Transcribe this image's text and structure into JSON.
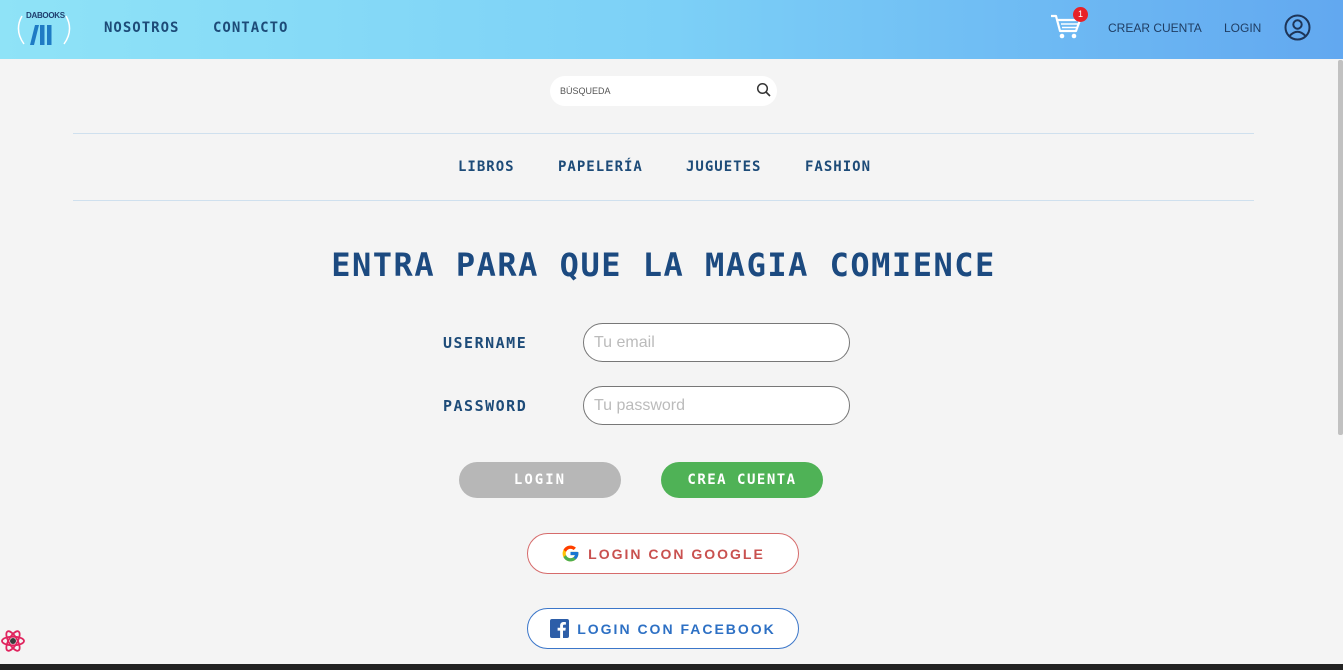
{
  "header": {
    "logo_text": "DABOOKS",
    "nav": [
      "NOSOTROS",
      "CONTACTO"
    ],
    "cart_count": "1",
    "create_account": "CREAR CUENTA",
    "login": "LOGIN"
  },
  "search": {
    "placeholder": "BÚSQUEDA"
  },
  "categories": [
    "LIBROS",
    "PAPELERÍA",
    "JUGUETES",
    "FASHION"
  ],
  "login_form": {
    "title": "ENTRA PARA QUE LA MAGIA COMIENCE",
    "username_label": "USERNAME",
    "username_placeholder": "Tu email",
    "password_label": "PASSWORD",
    "password_placeholder": "Tu password",
    "login_button": "LOGIN",
    "create_button": "CREA CUENTA",
    "google_button": "LOGIN CON GOOGLE",
    "facebook_button": "LOGIN CON FACEBOOK"
  },
  "colors": {
    "header_gradient_start": "#8fe3f7",
    "header_gradient_end": "#62a8f0",
    "primary_text": "#1d4b78",
    "create_green": "#4fb256",
    "login_gray": "#b7b7b7",
    "google_red": "#c9514f",
    "facebook_blue": "#2d70c4"
  },
  "icons": [
    "logo-icon",
    "cart-icon",
    "user-icon",
    "search-icon",
    "google-icon",
    "facebook-icon",
    "react-devtools-icon"
  ]
}
